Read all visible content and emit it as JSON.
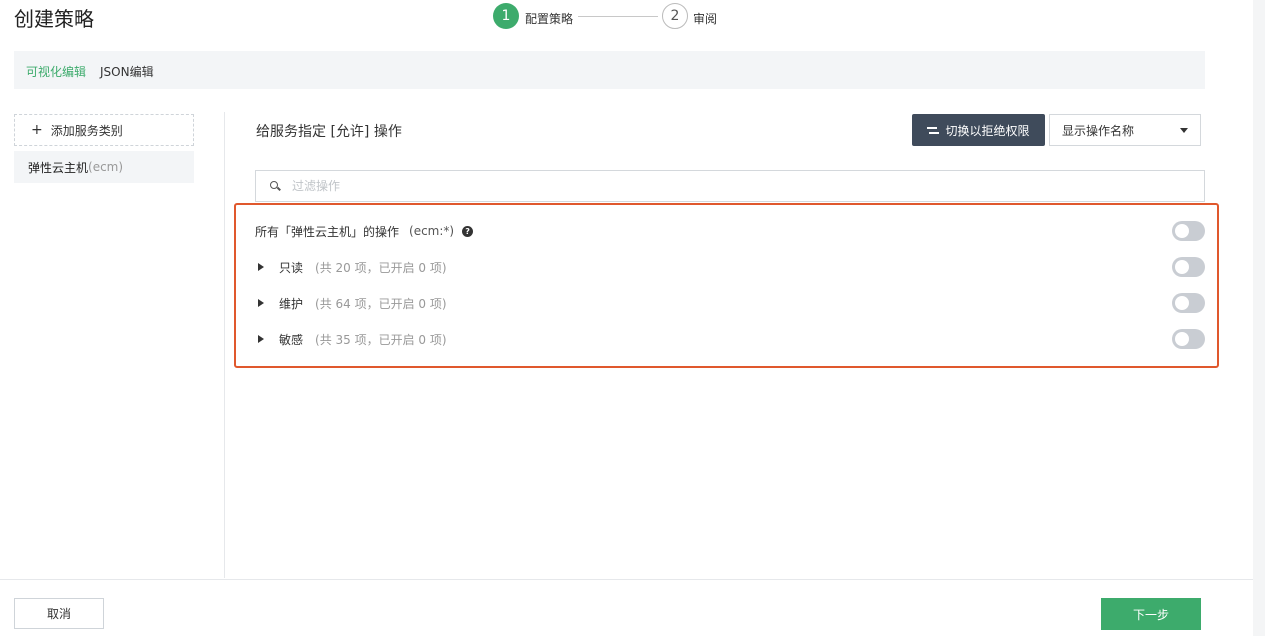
{
  "page": {
    "title": "创建策略"
  },
  "stepper": {
    "steps": [
      {
        "number": "1",
        "label": "配置策略"
      },
      {
        "number": "2",
        "label": "审阅"
      }
    ]
  },
  "editor_modes": {
    "visual": "可视化编辑",
    "json": "JSON编辑"
  },
  "sidebar": {
    "add_label": "添加服务类别",
    "service": {
      "name": "弹性云主机",
      "code": "(ecm)"
    }
  },
  "main": {
    "title": "给服务指定 [允许] 操作",
    "deny_button": "切换以拒绝权限",
    "display_select": "显示操作名称",
    "filter_placeholder": "过滤操作",
    "all_actions": {
      "label": "所有「弹性云主机」的操作",
      "code": "(ecm:*)",
      "enabled": false
    },
    "groups": [
      {
        "label": "只读",
        "meta": "(共 20 项，已开启 0 项)",
        "enabled": false
      },
      {
        "label": "维护",
        "meta": "(共 64 项，已开启 0 项)",
        "enabled": false
      },
      {
        "label": "敏感",
        "meta": "(共 35 项，已开启 0 项)",
        "enabled": false
      }
    ]
  },
  "footer": {
    "cancel": "取消",
    "next": "下一步"
  },
  "colors": {
    "accent": "#3dab6c",
    "highlight": "#e0582d",
    "dark_button": "#3f4b5b"
  }
}
